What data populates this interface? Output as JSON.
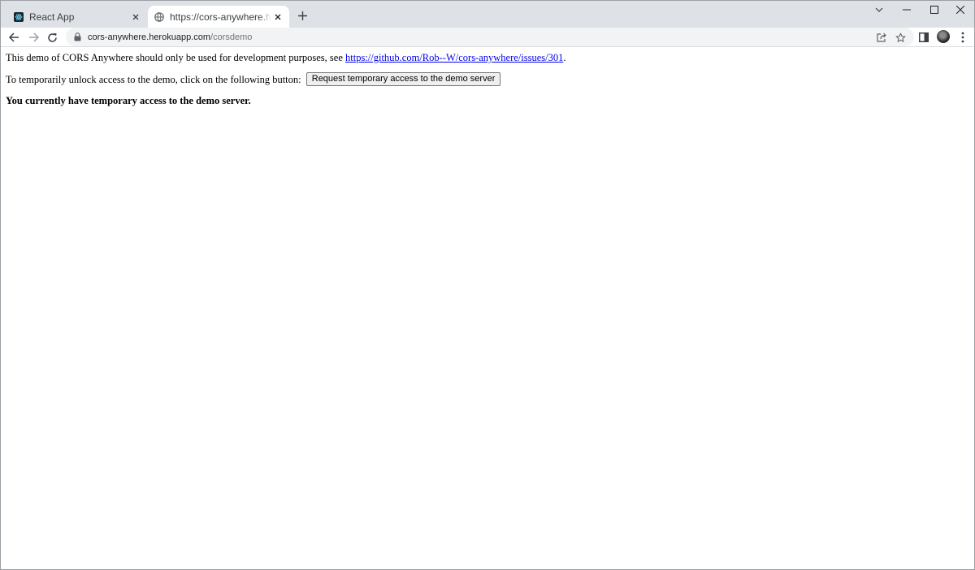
{
  "browser": {
    "tabs": [
      {
        "title": "React App",
        "icon": "react-icon",
        "active": false
      },
      {
        "title": "https://cors-anywhere.herokuapp.com/corsdemo",
        "icon": "globe-icon",
        "active": true
      }
    ],
    "address_bar": {
      "host": "cors-anywhere.herokuapp.com",
      "path": "/corsdemo"
    }
  },
  "page": {
    "line1_text": "This demo of CORS Anywhere should only be used for development purposes, see ",
    "line1_link": "https://github.com/Rob--W/cors-anywhere/issues/301",
    "line1_end": ".",
    "line2_text": "To temporarily unlock access to the demo, click on the following button: ",
    "button_label": "Request temporary access to the demo server",
    "status": "You currently have temporary access to the demo server."
  },
  "colors": {
    "tabstrip_bg": "#dee1e6",
    "omnibox_bg": "#f1f3f4",
    "link": "#0000ee"
  }
}
